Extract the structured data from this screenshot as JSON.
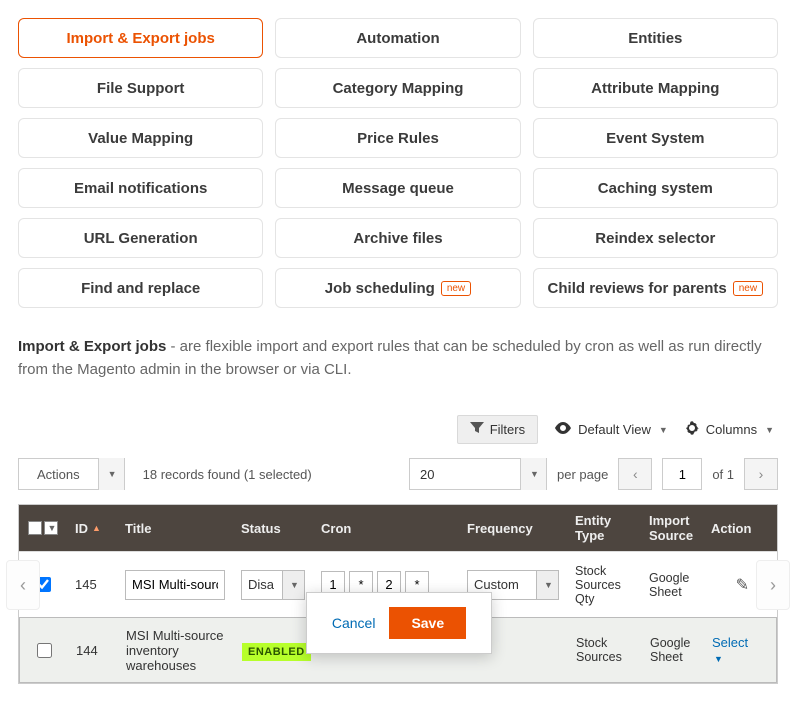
{
  "tabs": [
    {
      "label": "Import & Export jobs",
      "active": true
    },
    {
      "label": "Automation"
    },
    {
      "label": "Entities"
    },
    {
      "label": "File Support"
    },
    {
      "label": "Category Mapping"
    },
    {
      "label": "Attribute Mapping"
    },
    {
      "label": "Value Mapping"
    },
    {
      "label": "Price Rules"
    },
    {
      "label": "Event System"
    },
    {
      "label": "Email notifications"
    },
    {
      "label": "Message queue"
    },
    {
      "label": "Caching system"
    },
    {
      "label": "URL Generation"
    },
    {
      "label": "Archive files"
    },
    {
      "label": "Reindex selector"
    },
    {
      "label": "Find and replace"
    },
    {
      "label": "Job scheduling",
      "badge": "new"
    },
    {
      "label": "Child reviews for parents",
      "badge": "new"
    }
  ],
  "description": {
    "lead": "Import & Export jobs",
    "rest": " - are flexible import and export rules that can be scheduled by cron as well as run directly from the Magento admin in the browser or via CLI."
  },
  "toolbar": {
    "filters": "Filters",
    "default_view": "Default View",
    "columns": "Columns"
  },
  "grid_controls": {
    "actions": "Actions",
    "records": "18 records found (1 selected)",
    "per_page_value": "20",
    "per_page_label": "per page",
    "page_current": "1",
    "page_of": "of 1"
  },
  "columns": {
    "id": "ID",
    "title": "Title",
    "status": "Status",
    "cron": "Cron",
    "frequency": "Frequency",
    "entity_type": "Entity Type",
    "import_source": "Import Source",
    "action": "Action"
  },
  "rows": {
    "r1": {
      "id": "145",
      "title": "MSI Multi-source",
      "status": "Disa",
      "cron": [
        "1",
        "*",
        "2",
        "*"
      ],
      "frequency": "Custom",
      "entity_type": "Stock Sources Qty",
      "import_source": "Google Sheet"
    },
    "r2": {
      "id": "144",
      "title": "MSI Multi-source inventory warehouses",
      "status": "ENABLED",
      "entity_type": "Stock Sources",
      "import_source": "Google Sheet",
      "action": "Select"
    }
  },
  "popup": {
    "cancel": "Cancel",
    "save": "Save"
  }
}
